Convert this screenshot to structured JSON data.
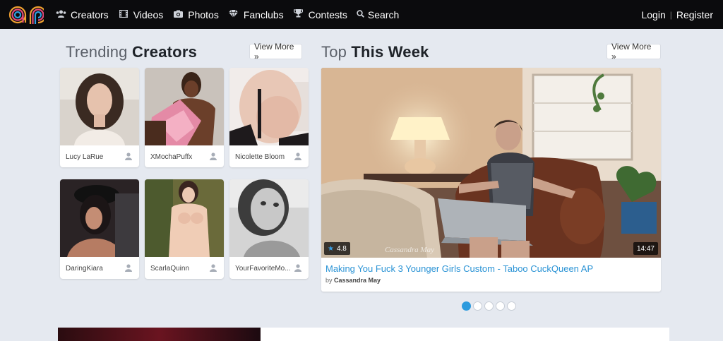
{
  "nav": {
    "items": [
      {
        "label": "Creators",
        "icon": "users-icon"
      },
      {
        "label": "Videos",
        "icon": "film-icon"
      },
      {
        "label": "Photos",
        "icon": "camera-icon"
      },
      {
        "label": "Fanclubs",
        "icon": "diamond-icon"
      },
      {
        "label": "Contests",
        "icon": "trophy-icon"
      },
      {
        "label": "Search",
        "icon": "search-icon"
      }
    ],
    "login": "Login",
    "register": "Register",
    "separator": "|"
  },
  "trending": {
    "title_light": "Trending",
    "title_bold": "Creators",
    "view_more": "View More »",
    "creators": [
      {
        "name": "Lucy LaRue"
      },
      {
        "name": "XMochaPuffx"
      },
      {
        "name": "Nicolette Bloom"
      },
      {
        "name": "DaringKiara"
      },
      {
        "name": "ScarlaQuinn"
      },
      {
        "name": "YourFavoriteMo..."
      }
    ]
  },
  "top_week": {
    "title_light": "Top",
    "title_bold": "This Week",
    "view_more": "View More »",
    "featured": {
      "rating": "4.8",
      "duration": "14:47",
      "watermark": "Cassandra May",
      "title": "Making You Fuck 3 Younger Girls Custom - Taboo CuckQueen AP",
      "by_label": "by",
      "author": "Cassandra May"
    },
    "slides": 5,
    "active_slide": 1
  },
  "colors": {
    "nav_bg": "#0b0b0d",
    "page_bg": "#e5e9f0",
    "accent": "#2a93d5"
  }
}
